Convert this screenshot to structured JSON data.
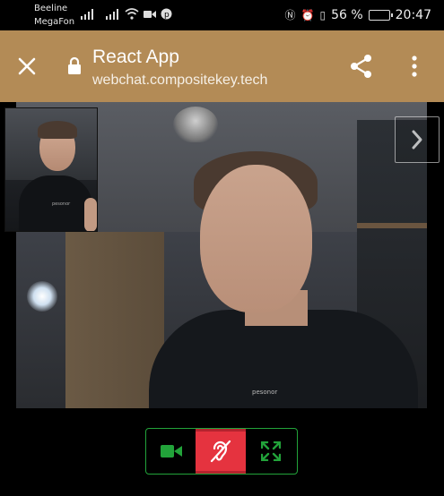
{
  "status_bar": {
    "carrier_1": "Beeline",
    "carrier_2": "MegaFon",
    "battery_percent": "56 %",
    "time": "20:47",
    "icons": [
      "signal-icon",
      "signal-icon",
      "wifi-icon",
      "video-record-icon",
      "pinterest-icon",
      "nfc-icon",
      "alarm-icon",
      "vibrate-icon",
      "battery-icon"
    ]
  },
  "browser_bar": {
    "title": "React App",
    "url": "webchat.compositekey.tech",
    "color": "#b38b56",
    "icons": [
      "close-icon",
      "lock-icon",
      "share-icon",
      "more-vert-icon"
    ]
  },
  "video": {
    "shirt_label": "pesonor",
    "self_shirt_label": "pesonor",
    "nav_icon": "chevron-right-icon"
  },
  "controls": {
    "accent": "#22a33a",
    "active_color": "#e5333f",
    "buttons": [
      {
        "icon": "video-camera-icon",
        "active": false
      },
      {
        "icon": "hearing-off-icon",
        "active": true
      },
      {
        "icon": "fullscreen-icon",
        "active": false
      }
    ]
  }
}
